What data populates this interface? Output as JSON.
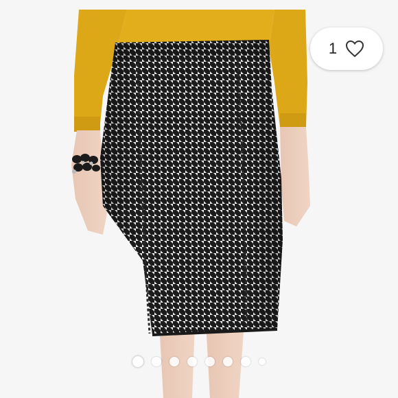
{
  "listing": {
    "like_count": "1",
    "like_icon": "heart-outline-icon"
  },
  "gallery": {
    "photo_count": 8,
    "current_index": 1,
    "photo_subject": "houndstooth-pencil-skirt-photo"
  },
  "colors": {
    "sweater": "#e2ae1c",
    "houndstooth_dark": "#1f1f1f",
    "houndstooth_light": "#ededed",
    "background": "#f6f6f6"
  }
}
